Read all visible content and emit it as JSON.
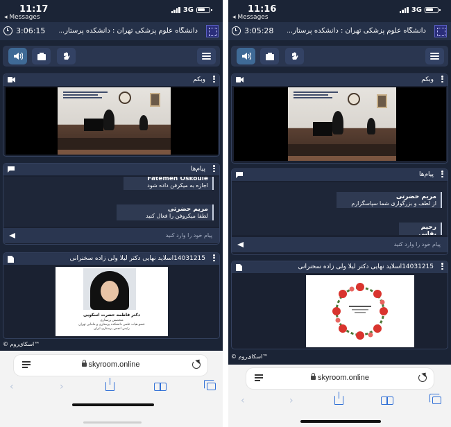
{
  "phones": [
    {
      "status": {
        "time": "11:17",
        "back_app": "◂ Messages",
        "network": "3G"
      },
      "header": {
        "timer": "3:06:15",
        "title": "دانشگاه علوم پزشکی تهران : دانشکده پرستار..."
      },
      "webcam": {
        "title": "وبکم"
      },
      "chat": {
        "title": "پیام‌ها",
        "messages": [
          {
            "sender": "Fatemeh Oskouie",
            "text": "اجازه به میکرفن داده شود"
          },
          {
            "sender": "مریم حضرتی",
            "text": "لطفا میکروفن را فعال کنید"
          }
        ],
        "placeholder": "پیام خود را وارد کنید"
      },
      "file": {
        "title": "14031215اسلاید نهایی دکتر لیلا ولی زاده سخنرانی",
        "slide_name": "دکتر فاطمه حضرت اسکویی",
        "slide_lines": [
          "متخصص پرستاری",
          "عضو هیات علمی دانشکده پرستاری و مامایی تهران",
          "رئیس انجمن پرستاری ایران"
        ]
      },
      "footer": "™اسکای‌روم ©",
      "browser": {
        "url": "skyroom.online"
      }
    },
    {
      "status": {
        "time": "11:16",
        "back_app": "◂ Messages",
        "network": "3G"
      },
      "header": {
        "timer": "3:05:28",
        "title": "دانشگاه علوم پزشکی تهران : دانشکده پرستار..."
      },
      "webcam": {
        "title": "وبکم"
      },
      "chat": {
        "title": "پیام‌ها",
        "messages": [
          {
            "sender": "مریم حضرتی",
            "text": "از لطف و بزرگواری شما سپاسگزارم"
          },
          {
            "sender": "رحیم بقایی",
            "text": ""
          }
        ],
        "placeholder": "پیام خود را وارد کنید"
      },
      "file": {
        "title": "14031215اسلاید نهایی دکتر لیلا ولی زاده سخنرانی",
        "slide_name": "",
        "slide_lines": []
      },
      "footer": "™اسکای‌روم ©",
      "browser": {
        "url": "skyroom.online"
      }
    }
  ]
}
